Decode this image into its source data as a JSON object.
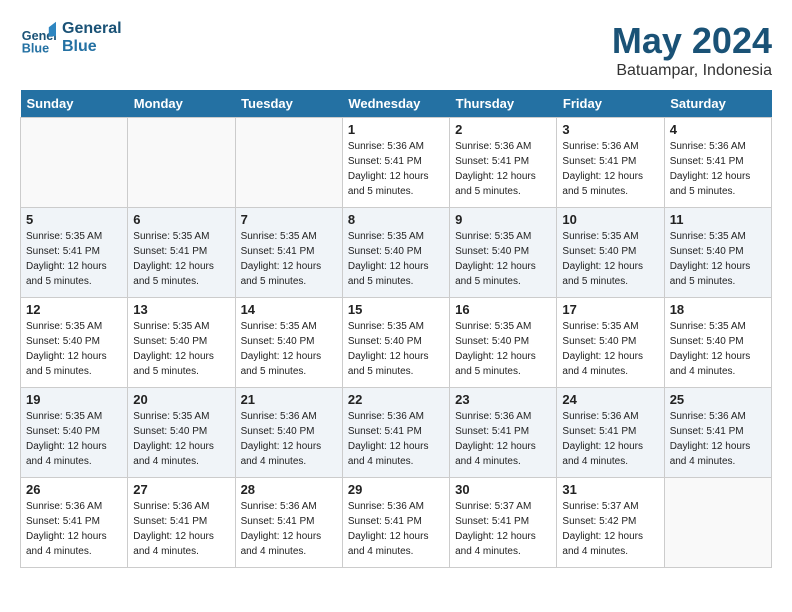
{
  "header": {
    "logo_line1": "General",
    "logo_line2": "Blue",
    "month": "May 2024",
    "location": "Batuampar, Indonesia"
  },
  "weekdays": [
    "Sunday",
    "Monday",
    "Tuesday",
    "Wednesday",
    "Thursday",
    "Friday",
    "Saturday"
  ],
  "weeks": [
    [
      {
        "day": "",
        "info": ""
      },
      {
        "day": "",
        "info": ""
      },
      {
        "day": "",
        "info": ""
      },
      {
        "day": "1",
        "info": "Sunrise: 5:36 AM\nSunset: 5:41 PM\nDaylight: 12 hours\nand 5 minutes."
      },
      {
        "day": "2",
        "info": "Sunrise: 5:36 AM\nSunset: 5:41 PM\nDaylight: 12 hours\nand 5 minutes."
      },
      {
        "day": "3",
        "info": "Sunrise: 5:36 AM\nSunset: 5:41 PM\nDaylight: 12 hours\nand 5 minutes."
      },
      {
        "day": "4",
        "info": "Sunrise: 5:36 AM\nSunset: 5:41 PM\nDaylight: 12 hours\nand 5 minutes."
      }
    ],
    [
      {
        "day": "5",
        "info": "Sunrise: 5:35 AM\nSunset: 5:41 PM\nDaylight: 12 hours\nand 5 minutes."
      },
      {
        "day": "6",
        "info": "Sunrise: 5:35 AM\nSunset: 5:41 PM\nDaylight: 12 hours\nand 5 minutes."
      },
      {
        "day": "7",
        "info": "Sunrise: 5:35 AM\nSunset: 5:41 PM\nDaylight: 12 hours\nand 5 minutes."
      },
      {
        "day": "8",
        "info": "Sunrise: 5:35 AM\nSunset: 5:40 PM\nDaylight: 12 hours\nand 5 minutes."
      },
      {
        "day": "9",
        "info": "Sunrise: 5:35 AM\nSunset: 5:40 PM\nDaylight: 12 hours\nand 5 minutes."
      },
      {
        "day": "10",
        "info": "Sunrise: 5:35 AM\nSunset: 5:40 PM\nDaylight: 12 hours\nand 5 minutes."
      },
      {
        "day": "11",
        "info": "Sunrise: 5:35 AM\nSunset: 5:40 PM\nDaylight: 12 hours\nand 5 minutes."
      }
    ],
    [
      {
        "day": "12",
        "info": "Sunrise: 5:35 AM\nSunset: 5:40 PM\nDaylight: 12 hours\nand 5 minutes."
      },
      {
        "day": "13",
        "info": "Sunrise: 5:35 AM\nSunset: 5:40 PM\nDaylight: 12 hours\nand 5 minutes."
      },
      {
        "day": "14",
        "info": "Sunrise: 5:35 AM\nSunset: 5:40 PM\nDaylight: 12 hours\nand 5 minutes."
      },
      {
        "day": "15",
        "info": "Sunrise: 5:35 AM\nSunset: 5:40 PM\nDaylight: 12 hours\nand 5 minutes."
      },
      {
        "day": "16",
        "info": "Sunrise: 5:35 AM\nSunset: 5:40 PM\nDaylight: 12 hours\nand 5 minutes."
      },
      {
        "day": "17",
        "info": "Sunrise: 5:35 AM\nSunset: 5:40 PM\nDaylight: 12 hours\nand 4 minutes."
      },
      {
        "day": "18",
        "info": "Sunrise: 5:35 AM\nSunset: 5:40 PM\nDaylight: 12 hours\nand 4 minutes."
      }
    ],
    [
      {
        "day": "19",
        "info": "Sunrise: 5:35 AM\nSunset: 5:40 PM\nDaylight: 12 hours\nand 4 minutes."
      },
      {
        "day": "20",
        "info": "Sunrise: 5:35 AM\nSunset: 5:40 PM\nDaylight: 12 hours\nand 4 minutes."
      },
      {
        "day": "21",
        "info": "Sunrise: 5:36 AM\nSunset: 5:40 PM\nDaylight: 12 hours\nand 4 minutes."
      },
      {
        "day": "22",
        "info": "Sunrise: 5:36 AM\nSunset: 5:41 PM\nDaylight: 12 hours\nand 4 minutes."
      },
      {
        "day": "23",
        "info": "Sunrise: 5:36 AM\nSunset: 5:41 PM\nDaylight: 12 hours\nand 4 minutes."
      },
      {
        "day": "24",
        "info": "Sunrise: 5:36 AM\nSunset: 5:41 PM\nDaylight: 12 hours\nand 4 minutes."
      },
      {
        "day": "25",
        "info": "Sunrise: 5:36 AM\nSunset: 5:41 PM\nDaylight: 12 hours\nand 4 minutes."
      }
    ],
    [
      {
        "day": "26",
        "info": "Sunrise: 5:36 AM\nSunset: 5:41 PM\nDaylight: 12 hours\nand 4 minutes."
      },
      {
        "day": "27",
        "info": "Sunrise: 5:36 AM\nSunset: 5:41 PM\nDaylight: 12 hours\nand 4 minutes."
      },
      {
        "day": "28",
        "info": "Sunrise: 5:36 AM\nSunset: 5:41 PM\nDaylight: 12 hours\nand 4 minutes."
      },
      {
        "day": "29",
        "info": "Sunrise: 5:36 AM\nSunset: 5:41 PM\nDaylight: 12 hours\nand 4 minutes."
      },
      {
        "day": "30",
        "info": "Sunrise: 5:37 AM\nSunset: 5:41 PM\nDaylight: 12 hours\nand 4 minutes."
      },
      {
        "day": "31",
        "info": "Sunrise: 5:37 AM\nSunset: 5:42 PM\nDaylight: 12 hours\nand 4 minutes."
      },
      {
        "day": "",
        "info": ""
      }
    ]
  ]
}
